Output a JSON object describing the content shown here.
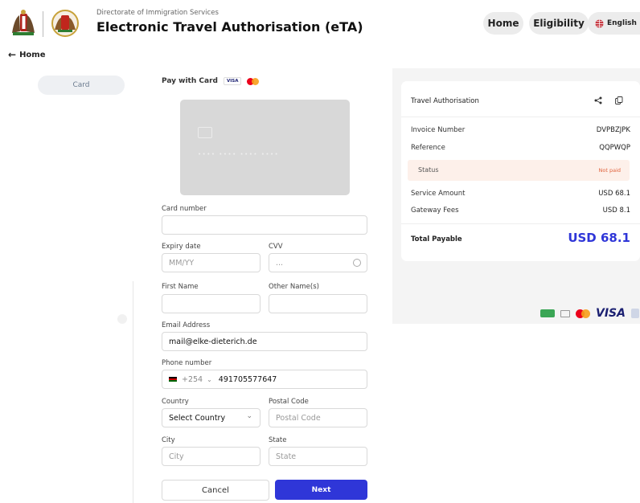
{
  "header": {
    "subtitle": "Directorate of Immigration Services",
    "title": "Electronic Travel Authorisation (eTA)",
    "nav": {
      "home": "Home",
      "eligibility": "Eligibility",
      "language": "English"
    }
  },
  "back_link": "Home",
  "sidebar": {
    "tab": "Card"
  },
  "payment": {
    "heading": "Pay with Card",
    "visa_badge": "VISA",
    "card_number_dots": "•••• •••• •••• ••••",
    "labels": {
      "card_number": "Card number",
      "expiry": "Expiry date",
      "cvv": "CVV",
      "first_name": "First Name",
      "other_names": "Other Name(s)",
      "email": "Email Address",
      "phone": "Phone number",
      "country": "Country",
      "postal": "Postal Code",
      "city": "City",
      "state": "State"
    },
    "placeholders": {
      "expiry": "MM/YY",
      "cvv": "...",
      "postal": "Postal Code",
      "city": "City",
      "state": "State"
    },
    "values": {
      "email": "mail@elke-dieterich.de",
      "dial_code": "+254",
      "phone": "491705577647",
      "country": "Select Country"
    },
    "buttons": {
      "cancel": "Cancel",
      "next": "Next"
    }
  },
  "summary": {
    "title": "Travel Authorisation",
    "invoice_label": "Invoice Number",
    "invoice_value": "DVPBZJPK",
    "reference_label": "Reference",
    "reference_value": "QQPWQP",
    "status_label": "Status",
    "status_value": "Not paid",
    "service_label": "Service Amount",
    "service_value": "USD 68.1",
    "gateway_label": "Gateway Fees",
    "gateway_value": "USD 8.1",
    "total_label": "Total Payable",
    "total_value": "USD 68.1"
  },
  "payment_logos": {
    "visa": "VISA"
  },
  "colors": {
    "accent": "#2f36d8",
    "status": "#e0623c",
    "status_bg": "#fdf0ea"
  }
}
